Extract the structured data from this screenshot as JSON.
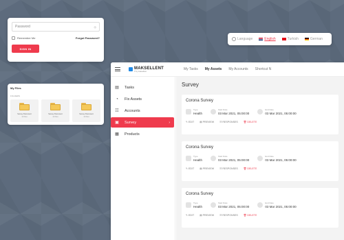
{
  "login": {
    "password_placeholder": "Password",
    "remember_label": "Remember Me",
    "forgot_label": "Forgot Password?",
    "signin_label": "SIGN IN"
  },
  "files": {
    "title": "My Files",
    "section": "FOLDERS",
    "folders": [
      {
        "name": "Survey Document",
        "count": "12 Files"
      },
      {
        "name": "Survey Document",
        "count": "12 Files"
      },
      {
        "name": "Survey Document",
        "count": "12 Files"
      }
    ]
  },
  "language": {
    "label": "Language",
    "options": [
      "English",
      "Turkish",
      "German"
    ],
    "selected": "English"
  },
  "app": {
    "logo_name": "MAKSELLENT",
    "logo_sub": "IT by makselllent",
    "topnav": [
      "My Tasks",
      "My Assets",
      "My Accounts",
      "Shortcut N"
    ],
    "topnav_active": "My Assets",
    "sidebar": [
      {
        "label": "Tasks",
        "icon": "tasks-icon"
      },
      {
        "label": "Fix Assets",
        "icon": "fix-assets-icon"
      },
      {
        "label": "Accounts",
        "icon": "accounts-icon"
      },
      {
        "label": "Survey",
        "icon": "survey-icon",
        "active": true
      },
      {
        "label": "Products",
        "icon": "products-icon"
      }
    ],
    "page_title": "Survey",
    "surveys": [
      {
        "title": "Corona Survey",
        "type_label": "Type",
        "type": "Health",
        "start_label": "Start Date",
        "start": "03 Mar 2021, 05:00:00",
        "end_label": "End Date",
        "end": "03 Mar 2021, 05:00:00"
      },
      {
        "title": "Corona Survey",
        "type_label": "Type",
        "type": "Health",
        "start_label": "Start Date",
        "start": "03 Mar 2021, 05:00:00",
        "end_label": "End Date",
        "end": "03 Mar 2021, 05:00:00"
      },
      {
        "title": "Corona Survey",
        "type_label": "Type",
        "type": "Health",
        "start_label": "Start Date",
        "start": "03 Mar 2021, 05:00:00",
        "end_label": "End Date",
        "end": "03 Mar 2021, 05:00:00"
      }
    ],
    "actions": {
      "edit": "EDIT",
      "preview": "PREVIEW",
      "responses": "RESPONSES",
      "delete": "DELETE"
    },
    "colors": {
      "accent": "#ef3b4d",
      "brand": "#1e88e5"
    }
  }
}
